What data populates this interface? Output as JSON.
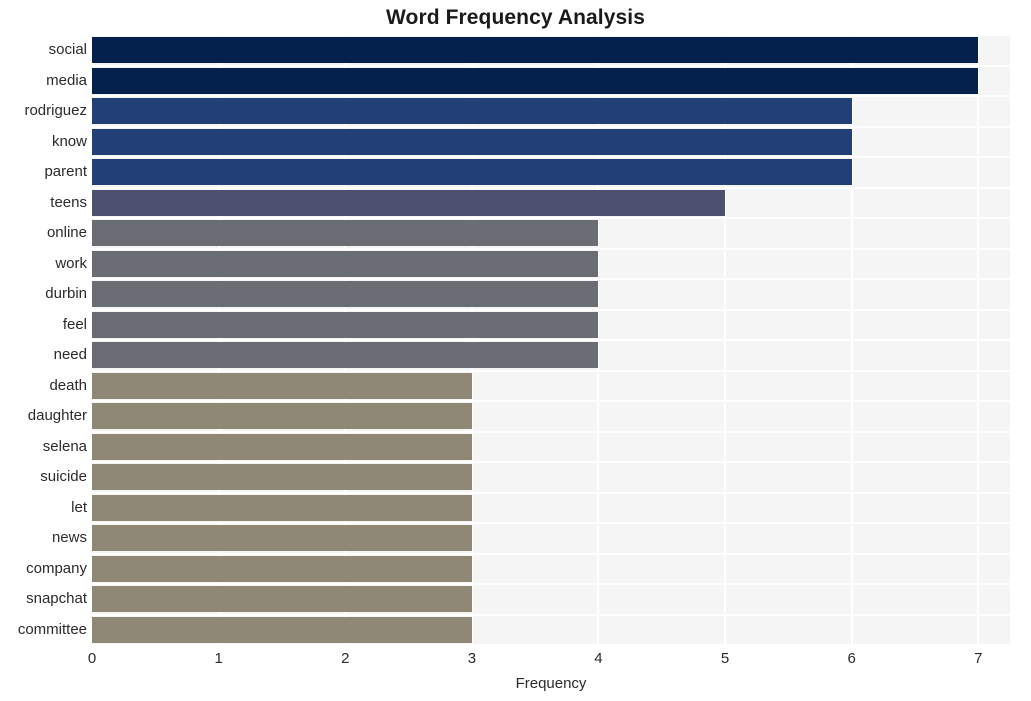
{
  "chart_data": {
    "type": "bar",
    "orientation": "horizontal",
    "title": "Word Frequency Analysis",
    "xlabel": "Frequency",
    "ylabel": "",
    "categories": [
      "social",
      "media",
      "rodriguez",
      "know",
      "parent",
      "teens",
      "online",
      "work",
      "durbin",
      "feel",
      "need",
      "death",
      "daughter",
      "selena",
      "suicide",
      "let",
      "news",
      "company",
      "snapchat",
      "committee"
    ],
    "values": [
      7,
      7,
      6,
      6,
      6,
      5,
      4,
      4,
      4,
      4,
      4,
      3,
      3,
      3,
      3,
      3,
      3,
      3,
      3,
      3
    ],
    "bar_colors": [
      "#04204c",
      "#04204c",
      "#233f77",
      "#233f77",
      "#233f77",
      "#4c5170",
      "#6b6d74",
      "#6b6d74",
      "#6b6d74",
      "#6b6d74",
      "#6b6d74",
      "#8e8875",
      "#8e8875",
      "#8e8875",
      "#8e8875",
      "#8e8875",
      "#8e8875",
      "#8e8875",
      "#8e8875",
      "#8e8875"
    ],
    "xlim": [
      0,
      7.25
    ],
    "xticks": [
      0,
      1,
      2,
      3,
      4,
      5,
      6,
      7
    ],
    "xtick_labels": [
      "0",
      "1",
      "2",
      "3",
      "4",
      "5",
      "6",
      "7"
    ],
    "grid": true,
    "grid_color": "#ffffff",
    "plot_background": "#f5f5f6",
    "figure_background": "#ffffff",
    "legend": null
  }
}
